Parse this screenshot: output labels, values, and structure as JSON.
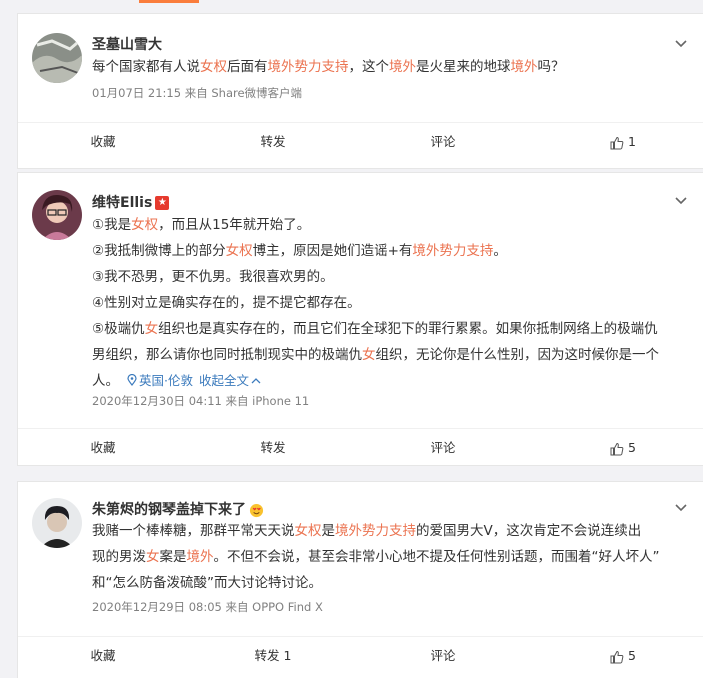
{
  "comments": [
    {
      "username": "圣墓山雪大",
      "text_parts": [
        {
          "t": "每个国家都有人说",
          "h": false
        },
        {
          "t": "女权",
          "h": true
        },
        {
          "t": "后面有",
          "h": false
        },
        {
          "t": "境外势力支持",
          "h": true
        },
        {
          "t": "，这个",
          "h": false
        },
        {
          "t": "境外",
          "h": true
        },
        {
          "t": "是火星来的地球",
          "h": false
        },
        {
          "t": "境外",
          "h": true
        },
        {
          "t": "吗？",
          "h": false
        }
      ],
      "meta": "01月07日 21:15  来自 Share微博客户端",
      "actions": {
        "collect": "收藏",
        "repost": "转发",
        "comment": "评论",
        "like": "1"
      }
    },
    {
      "username": "维特Ellis",
      "badge": "★",
      "lines": [
        [
          {
            "t": "①我是",
            "h": false
          },
          {
            "t": "女权",
            "h": true
          },
          {
            "t": "，而且从15年就开始了。",
            "h": false
          }
        ],
        [
          {
            "t": "②我抵制微博上的部分",
            "h": false
          },
          {
            "t": "女权",
            "h": true
          },
          {
            "t": "博主，原因是她们造谣+有",
            "h": false
          },
          {
            "t": "境外势力支持",
            "h": true
          },
          {
            "t": "。",
            "h": false
          }
        ],
        [
          {
            "t": "③我不恐男，更不仇男。我很喜欢男的。",
            "h": false
          }
        ],
        [
          {
            "t": "④性别对立是确实存在的，提不提它都存在。",
            "h": false
          }
        ],
        [
          {
            "t": "⑤极端仇",
            "h": false
          },
          {
            "t": "女",
            "h": true
          },
          {
            "t": "组织也是真实存在的，而且它们在全球犯下的罪行累累。如果你抵制网络上的极端仇",
            "h": false
          }
        ],
        [
          {
            "t": "男组织，那么请你也同时抵制现实中的极端仇",
            "h": false
          },
          {
            "t": "女",
            "h": true
          },
          {
            "t": "组织，无论你是什么性别，因为这时候你是一个",
            "h": false
          }
        ]
      ],
      "last_line": "人。",
      "location": "英国·伦敦",
      "collapse": "收起全文",
      "meta": "2020年12月30日 04:11  来自 iPhone 11",
      "actions": {
        "collect": "收藏",
        "repost": "转发",
        "comment": "评论",
        "like": "5"
      }
    },
    {
      "username": "朱第烬的钢琴盖掉下来了",
      "lines": [
        [
          {
            "t": "我赌一个棒棒糖，那群平常天天说",
            "h": false
          },
          {
            "t": "女权",
            "h": true
          },
          {
            "t": "是",
            "h": false
          },
          {
            "t": "境外势力支持",
            "h": true
          },
          {
            "t": "的爱国男大V，这次肯定不会说连续出",
            "h": false
          }
        ],
        [
          {
            "t": "现的男泼",
            "h": false
          },
          {
            "t": "女",
            "h": true
          },
          {
            "t": "案是",
            "h": false
          },
          {
            "t": "境外",
            "h": true
          },
          {
            "t": "。不但不会说，甚至会非常小心地不提及任何性别话题，而围着“好人坏人”",
            "h": false
          }
        ],
        [
          {
            "t": "和“怎么防备泼硫酸”而大讨论特讨论。",
            "h": false
          }
        ]
      ],
      "meta": "2020年12月29日 08:05  来自 OPPO Find X",
      "actions": {
        "collect": "收藏",
        "repost": "转发 1",
        "comment": "评论",
        "like": "5"
      }
    }
  ],
  "colors": {
    "highlight": "#eb7350",
    "accent": "#fa7d3c",
    "link": "#3c7bbd"
  }
}
